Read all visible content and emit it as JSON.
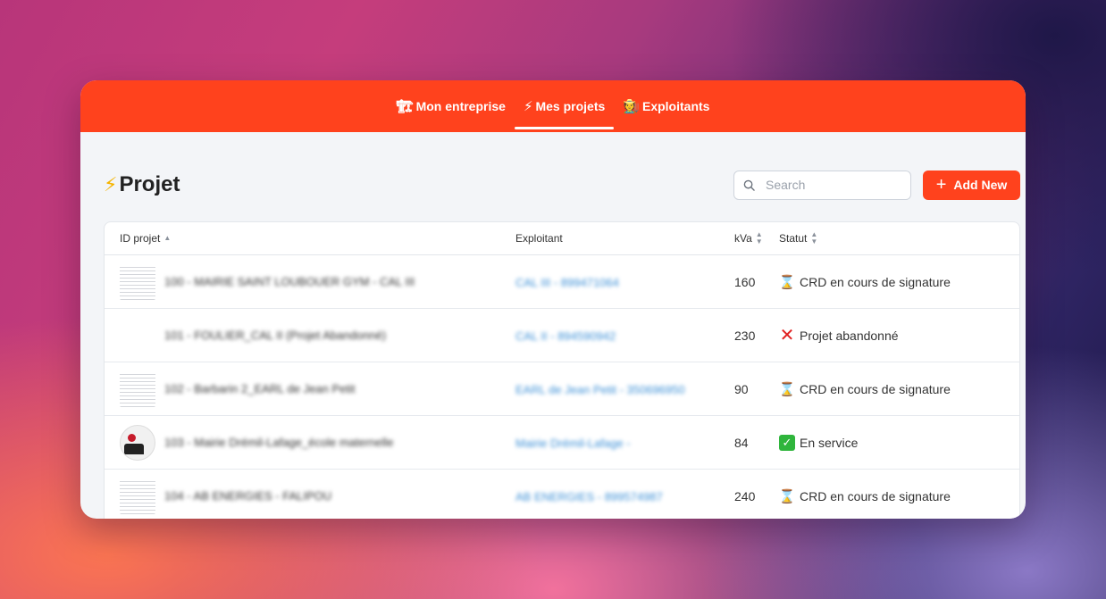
{
  "nav": {
    "items": [
      {
        "label": "Mon entreprise",
        "icon": "🏗"
      },
      {
        "label": "Mes projets",
        "icon": "⚡"
      },
      {
        "label": "Exploitants",
        "icon": "🧑‍🌾"
      }
    ]
  },
  "page": {
    "title_icon": "⚡",
    "title": "Projet"
  },
  "search": {
    "placeholder": "Search"
  },
  "toolbar": {
    "add_label": "Add New"
  },
  "table": {
    "headers": {
      "id": "ID projet",
      "exploitant": "Exploitant",
      "kva": "kVa",
      "statut": "Statut"
    },
    "rows": [
      {
        "name": "100 - MAIRIE SAINT LOUBOUER GYM - CAL III",
        "exploitant": "CAL III - 899471064",
        "kva": "160",
        "status": "CRD en cours de signature",
        "status_icon": "⌛"
      },
      {
        "name": "101 - FOULIER_CAL II (Projet Abandonné)",
        "exploitant": "CAL II - 894590942",
        "kva": "230",
        "status": "Projet abandonné",
        "status_icon": "✕"
      },
      {
        "name": "102 - Barbarin 2_EARL de Jean Petit",
        "exploitant": "EARL de Jean Petit - 350696950",
        "kva": "90",
        "status": "CRD en cours de signature",
        "status_icon": "⌛"
      },
      {
        "name": "103 - Mairie Drémil-Lafage_école maternelle",
        "exploitant": "Mairie Drémil-Lafage -",
        "kva": "84",
        "status": "En service",
        "status_icon": "✓"
      },
      {
        "name": "104 - AB ENERGIES - FALIPOU",
        "exploitant": "AB ENERGIES - 899574987",
        "kva": "240",
        "status": "CRD en cours de signature",
        "status_icon": "⌛"
      }
    ]
  },
  "colors": {
    "brand": "#ff421d",
    "link": "#3b8fd6"
  }
}
